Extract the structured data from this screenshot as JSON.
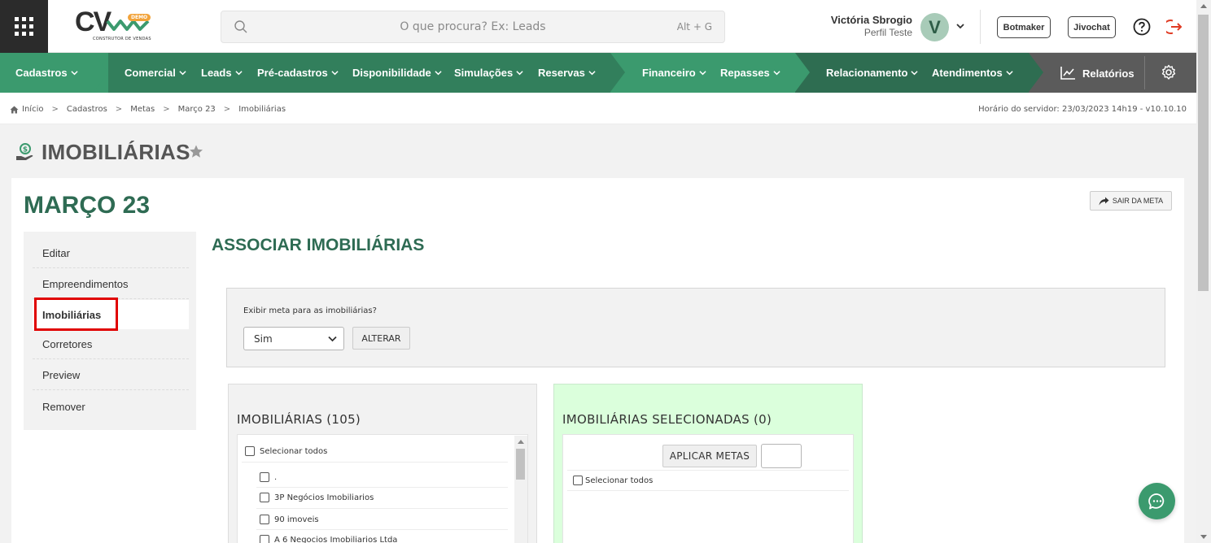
{
  "header": {
    "logo": {
      "text": "CV",
      "badge": "DEMO",
      "subtitle": "CONSTRUTOR DE VENDAS"
    },
    "search": {
      "placeholder": "O que procura? Ex: Leads",
      "shortcut": "Alt + G"
    },
    "user": {
      "name": "Victória Sbrogio",
      "role": "Perfil Teste",
      "initial": "V"
    },
    "buttons": {
      "botmaker": "Botmaker",
      "jivochat": "Jivochat"
    }
  },
  "nav": {
    "items": [
      {
        "label": "Cadastros"
      },
      {
        "label": "Comercial"
      },
      {
        "label": "Leads"
      },
      {
        "label": "Pré-cadastros"
      },
      {
        "label": "Disponibilidade"
      },
      {
        "label": "Simulações"
      },
      {
        "label": "Reservas"
      },
      {
        "label": "Financeiro"
      },
      {
        "label": "Repasses"
      },
      {
        "label": "Relacionamento"
      },
      {
        "label": "Atendimentos"
      }
    ],
    "reports": "Relatórios",
    "colors": {
      "green": "#3b9a6e",
      "dark_green": "#327f5c",
      "darker_green": "#2e6d51",
      "gray": "#5b5b5b"
    }
  },
  "breadcrumb": {
    "items": [
      "Início",
      "Cadastros",
      "Metas",
      "Março 23",
      "Imobiliárias"
    ],
    "server_time": "Horário do servidor: 23/03/2023 14h19 - v10.10.10"
  },
  "page": {
    "title": "IMOBILIÁRIAS",
    "meta_title": "MARÇO 23",
    "exit_meta": "SAIR DA META"
  },
  "sidemenu": {
    "items": [
      "Editar",
      "Empreendimentos",
      "Imobiliárias",
      "Corretores",
      "Preview",
      "Remover"
    ],
    "active": "Imobiliárias"
  },
  "main": {
    "title": "ASSOCIAR IMOBILIÁRIAS",
    "filter": {
      "label": "Exibir meta para as imobiliárias?",
      "selected": "Sim",
      "button": "ALTERAR"
    },
    "left_panel": {
      "title": "IMOBILIÁRIAS (105)",
      "select_all": "Selecionar todos",
      "items": [
        ".",
        "3P Negócios Imobiliarios",
        "90 imoveis",
        "A 6 Negocios Imobiliarios Ltda"
      ]
    },
    "right_panel": {
      "title": "IMOBILIÁRIAS SELECIONADAS (0)",
      "apply_button": "APLICAR METAS",
      "select_all": "Selecionar todos"
    }
  }
}
